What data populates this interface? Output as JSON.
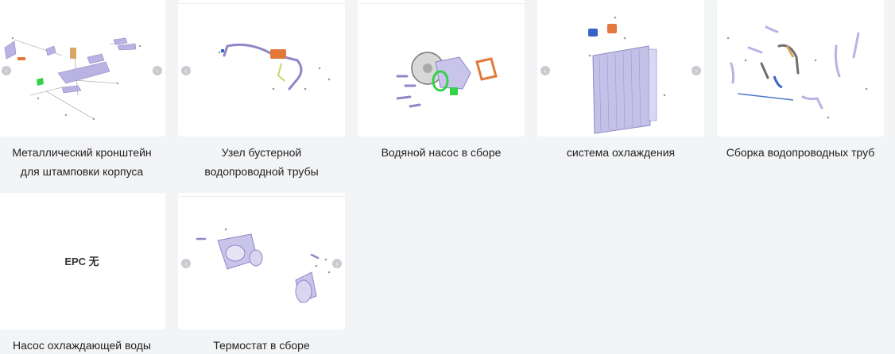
{
  "cards": [
    {
      "caption": "Металлический кронштейн для штамповки корпуса",
      "thumbnail_icon": "bracket-assembly-diagram"
    },
    {
      "caption": "Узел бустерной водопроводной трубы",
      "thumbnail_icon": "booster-pipe-diagram"
    },
    {
      "caption": "Водяной насос в сборе",
      "thumbnail_icon": "water-pump-diagram"
    },
    {
      "caption": "система охлаждения",
      "thumbnail_icon": "cooling-system-diagram"
    },
    {
      "caption": "Сборка водопроводных труб",
      "thumbnail_icon": "water-pipes-diagram"
    },
    {
      "caption": "Насос охлаждающей воды",
      "placeholder": "EPC 无"
    },
    {
      "caption": "Термостат в сборе",
      "thumbnail_icon": "thermostat-diagram"
    }
  ],
  "nav": {
    "prev": "‹",
    "next": "›"
  },
  "colors": {
    "page_bg": "#f3f4f6",
    "card_bg": "#ffffff",
    "part_purple": "#b9b3e3",
    "part_green": "#35d14a",
    "part_orange": "#e2783a",
    "part_blue": "#3a63c8"
  }
}
